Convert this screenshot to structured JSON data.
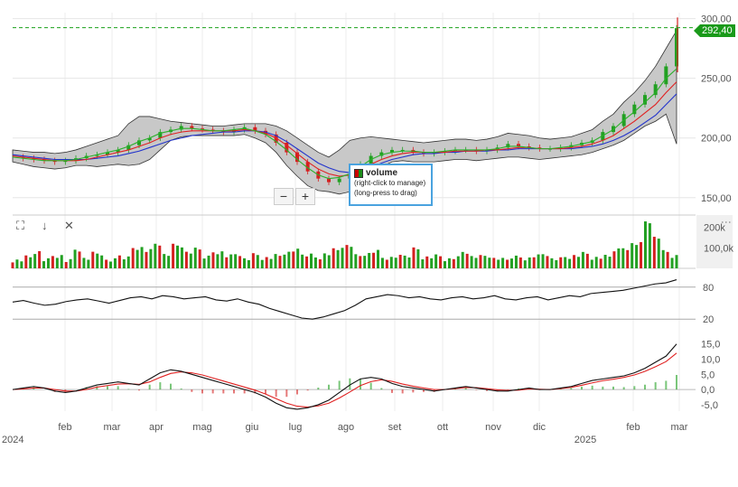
{
  "colors": {
    "up": "#22a022",
    "down": "#d42020",
    "band_fill": "#c8c8c8",
    "sma_fast": "#2ab02a",
    "sma_mid": "#e02020",
    "sma_slow": "#2233cc",
    "last_line": "#1aa01a",
    "osc": "#111111"
  },
  "price_axis": {
    "ticks": [
      "300,00",
      "250,00",
      "200,00",
      "150,00"
    ],
    "last_price": "292,40"
  },
  "volume_axis": {
    "ticks": [
      "200k",
      "100,0k"
    ]
  },
  "rsi_axis": {
    "ticks": [
      "80",
      "20"
    ]
  },
  "macd_axis": {
    "ticks": [
      "15,0",
      "10,0",
      "5,0",
      "0,0",
      "-5,0"
    ]
  },
  "x_axis": {
    "months": [
      "feb",
      "mar",
      "apr",
      "mag",
      "giu",
      "lug",
      "ago",
      "set",
      "ott",
      "nov",
      "dic",
      "feb",
      "mar"
    ],
    "years": [
      "2024",
      "2025"
    ]
  },
  "tooltip": {
    "title": "volume",
    "line1": "(right-click to manage)",
    "line2": "(long-press to drag)"
  },
  "controls": {
    "zoom_out": "−",
    "zoom_in": "+",
    "fullscreen_icon": "⛶",
    "download_icon": "↓",
    "close_icon": "✕",
    "menu_icon": "⋮"
  },
  "chart_data": [
    {
      "type": "candlestick",
      "panel": "price",
      "ylim": [
        140,
        305
      ],
      "last_price": 292.4,
      "series": [
        {
          "name": "close",
          "values": [
            184,
            183,
            182,
            181,
            180,
            181,
            183,
            185,
            186,
            188,
            190,
            194,
            198,
            200,
            205,
            207,
            210,
            208,
            207,
            206,
            205,
            207,
            209,
            206,
            203,
            196,
            188,
            180,
            172,
            166,
            163,
            166,
            170,
            178,
            185,
            188,
            190,
            190,
            188,
            187,
            188,
            189,
            190,
            190,
            189,
            190,
            192,
            195,
            193,
            192,
            191,
            191,
            192,
            194,
            196,
            198,
            205,
            210,
            220,
            228,
            236,
            245,
            260,
            292
          ]
        },
        {
          "name": "sma_fast",
          "values": [
            184,
            183,
            182,
            181,
            181,
            181,
            182,
            184,
            186,
            188,
            190,
            193,
            197,
            200,
            204,
            206,
            208,
            208,
            207,
            206,
            206,
            207,
            208,
            206,
            203,
            197,
            190,
            182,
            175,
            169,
            166,
            167,
            170,
            176,
            182,
            186,
            188,
            189,
            189,
            188,
            188,
            189,
            190,
            190,
            190,
            190,
            191,
            193,
            193,
            192,
            191,
            191,
            192,
            193,
            195,
            197,
            202,
            207,
            215,
            222,
            230,
            238,
            250,
            258
          ]
        },
        {
          "name": "sma_mid",
          "values": [
            185,
            184,
            183,
            182,
            181,
            181,
            181,
            182,
            184,
            186,
            188,
            190,
            193,
            196,
            200,
            203,
            205,
            206,
            206,
            206,
            206,
            206,
            207,
            206,
            204,
            200,
            194,
            187,
            180,
            174,
            170,
            168,
            169,
            173,
            178,
            182,
            185,
            187,
            188,
            188,
            188,
            188,
            189,
            189,
            189,
            190,
            190,
            191,
            192,
            192,
            191,
            191,
            191,
            192,
            193,
            195,
            198,
            202,
            208,
            214,
            221,
            228,
            238,
            247
          ]
        },
        {
          "name": "sma_slow",
          "values": [
            186,
            185,
            184,
            183,
            182,
            182,
            182,
            182,
            183,
            184,
            185,
            187,
            189,
            192,
            195,
            198,
            200,
            202,
            203,
            204,
            205,
            205,
            206,
            206,
            205,
            202,
            197,
            191,
            185,
            179,
            175,
            172,
            171,
            172,
            175,
            179,
            182,
            184,
            186,
            187,
            187,
            188,
            188,
            189,
            189,
            189,
            190,
            190,
            191,
            191,
            191,
            191,
            191,
            191,
            192,
            193,
            195,
            198,
            202,
            207,
            213,
            219,
            228,
            237
          ]
        },
        {
          "name": "band_upper",
          "values": [
            190,
            189,
            188,
            188,
            187,
            188,
            190,
            193,
            196,
            199,
            202,
            212,
            218,
            218,
            216,
            214,
            213,
            212,
            211,
            210,
            210,
            211,
            212,
            212,
            212,
            210,
            206,
            200,
            194,
            188,
            184,
            190,
            198,
            200,
            201,
            200,
            199,
            198,
            197,
            196,
            197,
            198,
            199,
            199,
            198,
            199,
            201,
            204,
            203,
            202,
            200,
            199,
            200,
            201,
            204,
            207,
            214,
            220,
            230,
            238,
            248,
            260,
            275,
            290
          ]
        },
        {
          "name": "band_lower",
          "values": [
            180,
            178,
            176,
            175,
            174,
            175,
            177,
            177,
            176,
            177,
            178,
            177,
            178,
            182,
            190,
            198,
            201,
            202,
            202,
            202,
            202,
            202,
            203,
            200,
            196,
            188,
            177,
            168,
            160,
            156,
            155,
            153,
            155,
            162,
            170,
            176,
            180,
            181,
            180,
            180,
            180,
            181,
            182,
            182,
            181,
            182,
            183,
            184,
            184,
            183,
            182,
            183,
            184,
            185,
            186,
            188,
            191,
            194,
            198,
            204,
            210,
            214,
            220,
            195
          ]
        }
      ]
    },
    {
      "type": "bar",
      "panel": "volume",
      "ylim": [
        0,
        260
      ],
      "series": [
        {
          "name": "volume",
          "values": [
            40,
            55,
            80,
            40,
            60,
            35,
            90,
            45,
            70,
            35,
            60,
            50,
            100,
            85,
            120,
            65,
            110,
            75,
            90,
            55,
            80,
            60,
            70,
            45,
            65,
            50,
            60,
            75,
            85,
            65,
            55,
            70,
            90,
            110,
            60,
            70,
            80,
            50,
            55,
            60,
            95,
            55,
            60,
            45,
            50,
            80,
            55,
            60,
            45,
            40,
            55,
            50,
            60,
            70,
            45,
            55,
            60,
            70,
            50,
            55,
            90,
            100,
            120,
            230,
            150,
            80,
            60
          ]
        }
      ]
    },
    {
      "type": "line",
      "panel": "oscillator_1",
      "ylim": [
        0,
        100
      ],
      "series": [
        {
          "name": "oscillator",
          "values": [
            52,
            55,
            50,
            46,
            48,
            53,
            56,
            58,
            54,
            50,
            55,
            60,
            62,
            58,
            64,
            62,
            58,
            60,
            62,
            56,
            54,
            58,
            52,
            48,
            40,
            34,
            28,
            22,
            20,
            24,
            30,
            36,
            46,
            58,
            62,
            66,
            64,
            60,
            62,
            58,
            56,
            60,
            62,
            58,
            60,
            64,
            58,
            56,
            60,
            62,
            56,
            60,
            64,
            62,
            68,
            70,
            72,
            74,
            78,
            82,
            86,
            88,
            94
          ]
        }
      ]
    },
    {
      "type": "line",
      "panel": "oscillator_2",
      "ylim": [
        -8,
        17
      ],
      "series": [
        {
          "name": "line_a",
          "values": [
            0,
            0.5,
            1,
            0.5,
            -0.5,
            -1,
            -0.5,
            0.5,
            1.5,
            2,
            2.5,
            2,
            1.5,
            3.5,
            5.5,
            6.5,
            6,
            5,
            4,
            3,
            2,
            1,
            0,
            -1,
            -2.5,
            -4.5,
            -6,
            -6.5,
            -6,
            -5,
            -3.5,
            -1,
            1.5,
            3.5,
            4,
            3.5,
            2,
            1,
            0.5,
            0,
            -0.5,
            0,
            0.5,
            1,
            0.5,
            0,
            -0.5,
            -0.5,
            0,
            0.5,
            0,
            0,
            0.5,
            1,
            2,
            3,
            3.5,
            4,
            4.5,
            5.5,
            7,
            9,
            11,
            15
          ]
        },
        {
          "name": "line_b",
          "values": [
            0,
            0.2,
            0.5,
            0.5,
            0,
            -0.5,
            -0.5,
            0,
            0.8,
            1.3,
            1.8,
            1.9,
            1.7,
            2.5,
            4,
            5.3,
            5.8,
            5.5,
            4.8,
            3.8,
            2.8,
            1.8,
            0.8,
            -0.2,
            -1.5,
            -3,
            -4.5,
            -5.5,
            -5.8,
            -5.4,
            -4.5,
            -2.8,
            -0.8,
            1.3,
            2.6,
            3.2,
            2.7,
            1.8,
            1.1,
            0.5,
            0,
            0,
            0.3,
            0.7,
            0.6,
            0.3,
            -0.1,
            -0.3,
            -0.2,
            0.2,
            0.1,
            0,
            0.3,
            0.7,
            1.4,
            2.2,
            2.9,
            3.4,
            4,
            4.8,
            6,
            7.5,
            9.2,
            12
          ]
        }
      ]
    }
  ]
}
